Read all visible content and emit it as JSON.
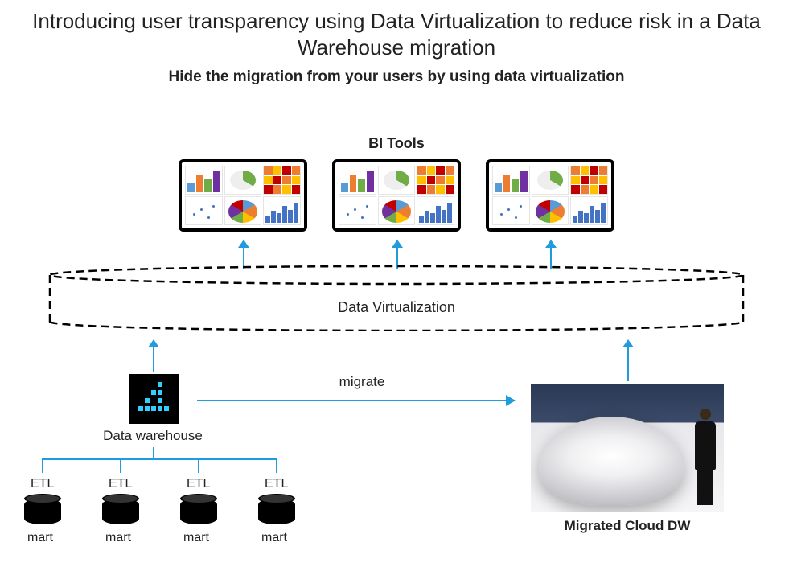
{
  "title": "Introducing user transparency using Data Virtualization to reduce risk in a Data Warehouse migration",
  "subtitle": "Hide the migration from your users by using data virtualization",
  "bi_tools_label": "BI Tools",
  "data_virtualization_label": "Data Virtualization",
  "data_warehouse_label": "Data warehouse",
  "migrate_label": "migrate",
  "migrated_cloud_label": "Migrated Cloud DW",
  "etl": [
    "ETL",
    "ETL",
    "ETL",
    "ETL"
  ],
  "mart": [
    "mart",
    "mart",
    "mart",
    "mart"
  ]
}
